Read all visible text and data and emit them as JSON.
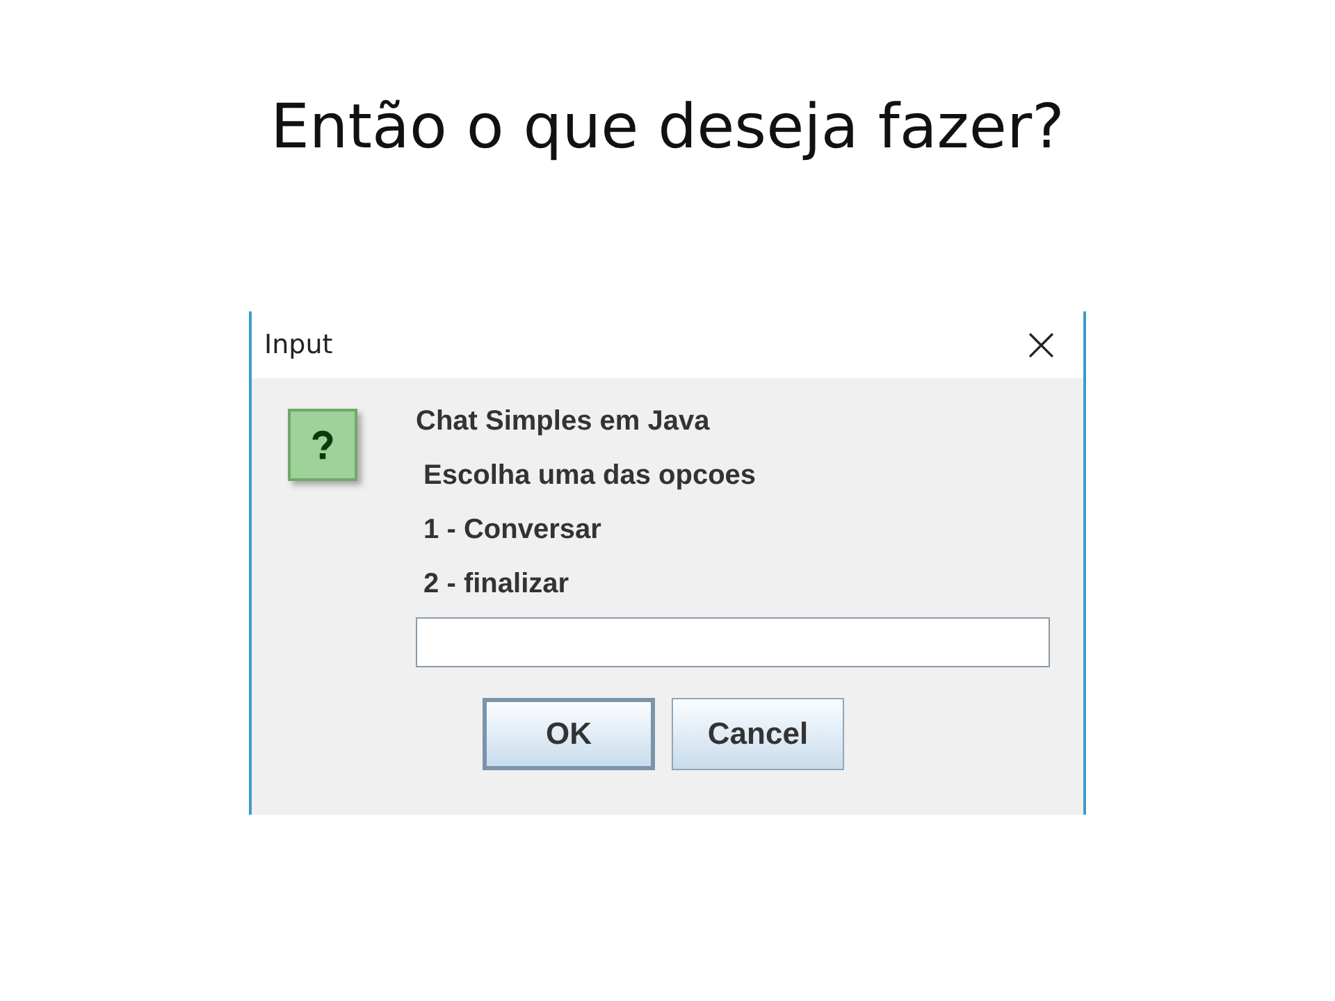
{
  "slide_title": "Então o que deseja fazer?",
  "dialog": {
    "title": "Input",
    "close_glyph": "×",
    "message_lines": [
      "Chat Simples em Java",
      " Escolha uma das opcoes",
      " 1 - Conversar",
      " 2 - finalizar"
    ],
    "buttons": [
      {
        "label": "OK",
        "focused": true
      },
      {
        "label": "Cancel",
        "focused": false
      }
    ]
  }
}
